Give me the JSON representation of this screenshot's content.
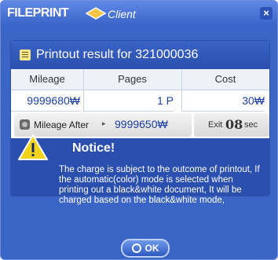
{
  "window": {
    "brand_file": "FILE",
    "brand_print": "PRINT",
    "brand_client": "Client",
    "close_label": "×"
  },
  "result": {
    "title": "Printout result for 321000036",
    "columns": [
      "Mileage",
      "Pages",
      "Cost"
    ],
    "values": {
      "mileage": "9999680₩",
      "pages": "1 P",
      "cost": "30₩"
    }
  },
  "mileage_after": {
    "label": "Mileage After",
    "arrow": "▸",
    "value": "9999650₩"
  },
  "exit": {
    "label": "Exit",
    "seconds": "08",
    "unit": "sec"
  },
  "notice": {
    "title": "Notice!",
    "text": "The charge is subject to the outcome of printout, If the automatic(color) mode is selected when printing out a black&white document, It will be charged based on the black&white mode,"
  },
  "ok_button": {
    "label": "OK"
  },
  "colors": {
    "frame": "#3b64c7",
    "header": "#2a4fae",
    "value_text": "#1a3fa8",
    "warning": "#f2d31b"
  },
  "icons": [
    "logo-icon",
    "close-icon",
    "document-icon",
    "coin-icon",
    "warning-icon",
    "ok-icon"
  ]
}
